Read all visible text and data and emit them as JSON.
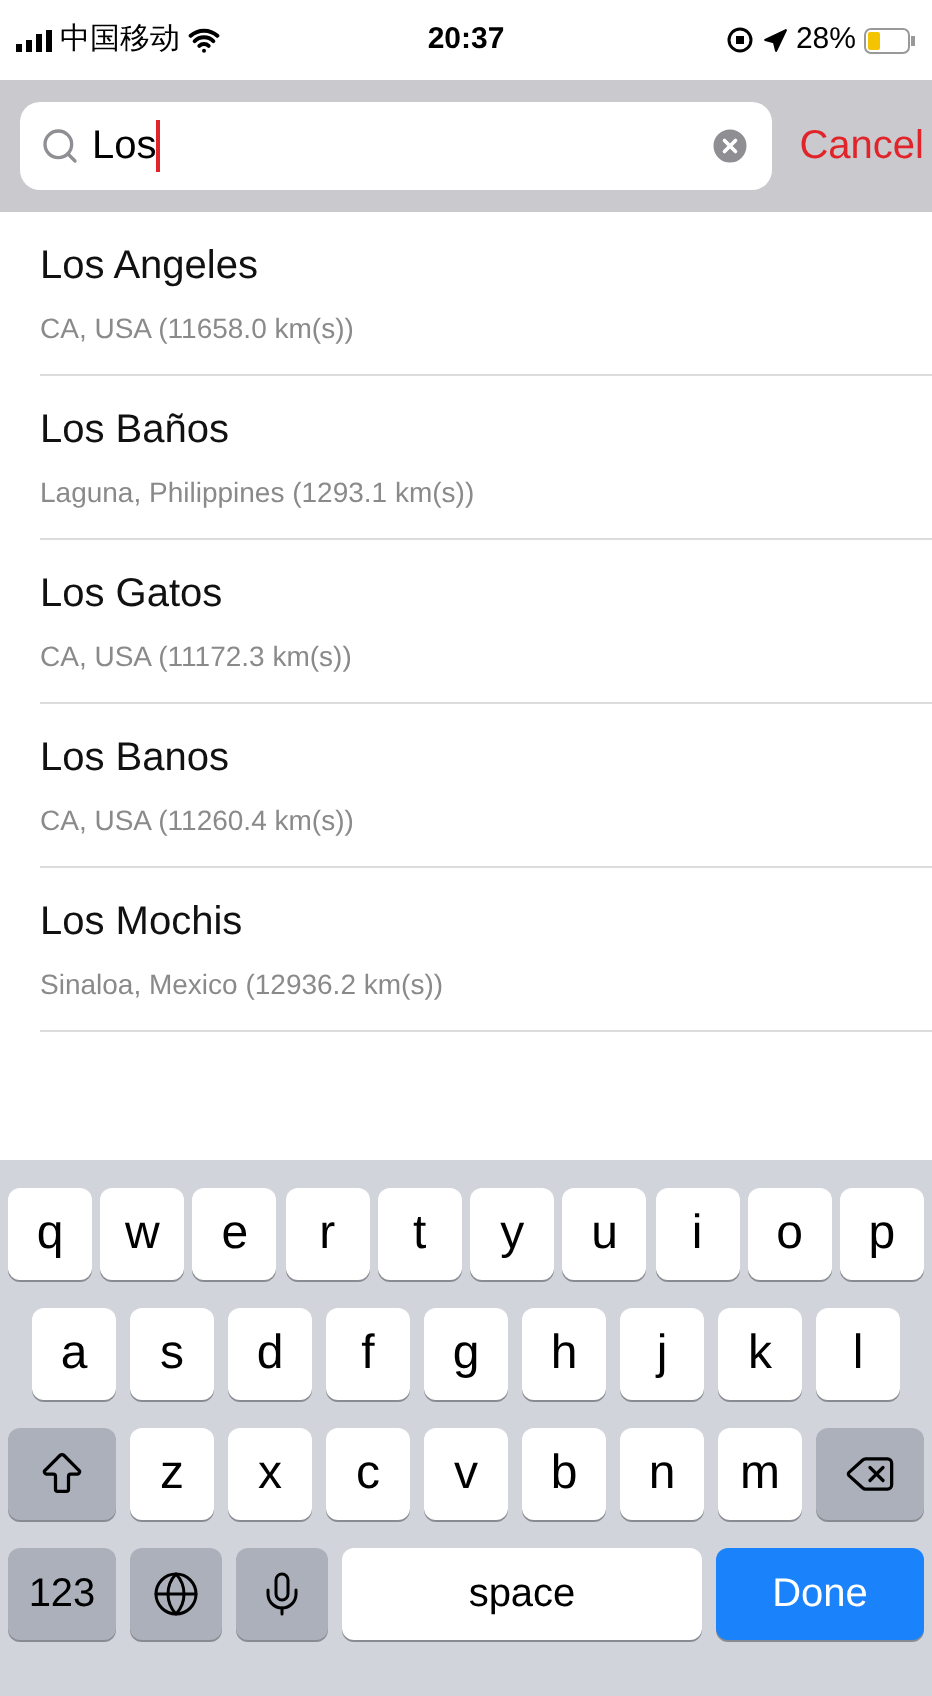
{
  "status_bar": {
    "carrier": "中国移动",
    "time": "20:37",
    "battery": "28%"
  },
  "search": {
    "value": "Los",
    "cancel": "Cancel"
  },
  "results": [
    {
      "name": "Los Angeles",
      "detail": "CA, USA (11658.0 km(s))"
    },
    {
      "name": "Los Baños",
      "detail": "Laguna, Philippines (1293.1 km(s))"
    },
    {
      "name": "Los Gatos",
      "detail": "CA, USA (11172.3 km(s))"
    },
    {
      "name": "Los Banos",
      "detail": "CA, USA (11260.4 km(s))"
    },
    {
      "name": "Los Mochis",
      "detail": "Sinaloa, Mexico (12936.2 km(s))"
    }
  ],
  "keyboard": {
    "rows": [
      [
        "q",
        "w",
        "e",
        "r",
        "t",
        "y",
        "u",
        "i",
        "o",
        "p"
      ],
      [
        "a",
        "s",
        "d",
        "f",
        "g",
        "h",
        "j",
        "k",
        "l"
      ],
      [
        "z",
        "x",
        "c",
        "v",
        "b",
        "n",
        "m"
      ]
    ],
    "numbers": "123",
    "space": "space",
    "done": "Done"
  }
}
